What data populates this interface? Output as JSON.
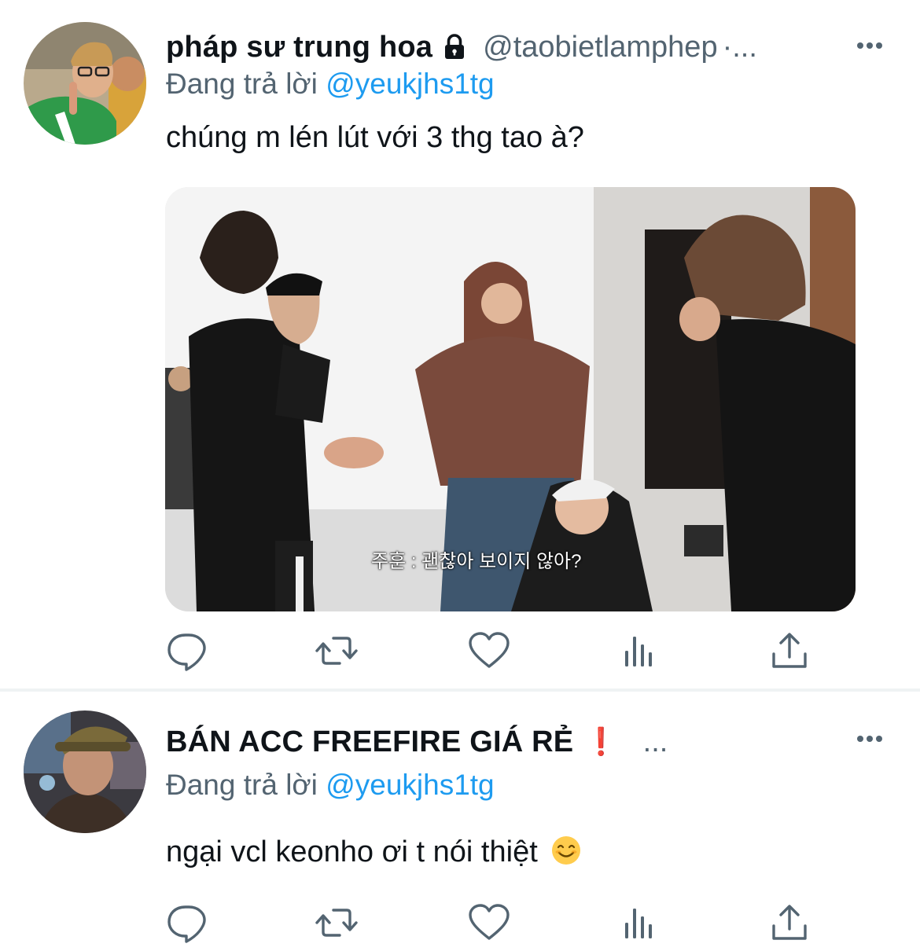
{
  "tweets": [
    {
      "author_name": "pháp sư trung hoa",
      "author_handle": "@taobietlamphep",
      "handle_overflow": "·...",
      "replying_prefix": "Đang trả lời",
      "replying_to": "@yeukjhs1tg",
      "text": "chúng m lén lút với 3 thg tao à?",
      "media_subtitle": "주훈 : 괜찮아 보이지 않아?",
      "locked": true
    },
    {
      "author_name": "BÁN ACC FREEFIRE GIÁ RẺ",
      "name_badge": "❗",
      "handle_overflow": "...",
      "replying_prefix": "Đang trả lời",
      "replying_to": "@yeukjhs1tg",
      "text": "ngại vcl keonho ơi t nói thiệt",
      "text_emoji": "smiling-face-icon"
    }
  ],
  "icons": {
    "reply": "speech-bubble-icon",
    "retweet": "retweet-arrows-icon",
    "like": "heart-icon",
    "views": "bar-chart-icon",
    "share": "share-upload-icon",
    "more": "three-dots-icon",
    "lock": "lock-icon"
  },
  "colors": {
    "text_primary": "#0f1419",
    "text_secondary": "#536471",
    "link": "#1d9bf0",
    "icon": "#536471",
    "divider": "#eff3f4",
    "alert": "#e0245e"
  }
}
